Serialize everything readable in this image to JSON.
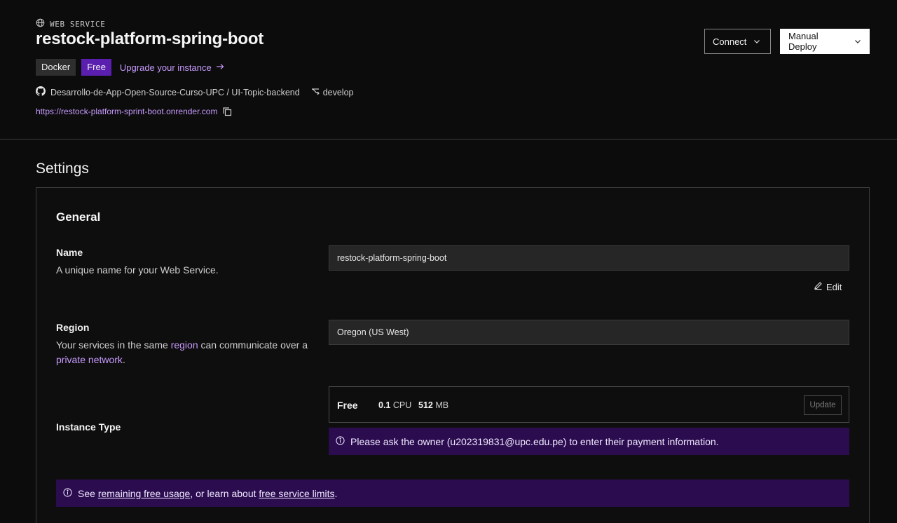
{
  "header": {
    "service_type": "WEB SERVICE",
    "title": "restock-platform-spring-boot",
    "badges": {
      "runtime": "Docker",
      "plan": "Free"
    },
    "upgrade_link": "Upgrade your instance",
    "repo": "Desarrollo-de-App-Open-Source-Curso-UPC / UI-Topic-backend",
    "branch": "develop",
    "url": "https://restock-platform-sprint-boot.onrender.com",
    "connect_label": "Connect",
    "deploy_label": "Manual Deploy"
  },
  "settings": {
    "title": "Settings",
    "general_title": "General",
    "name": {
      "label": "Name",
      "description": "A unique name for your Web Service.",
      "value": "restock-platform-spring-boot",
      "edit_label": "Edit"
    },
    "region": {
      "label": "Region",
      "desc_prefix": "Your services in the same ",
      "desc_link1": "region",
      "desc_middle": " can communicate over a ",
      "desc_link2": "private network",
      "desc_suffix": ".",
      "value": "Oregon (US West)"
    },
    "instance": {
      "label": "Instance Type",
      "plan": "Free",
      "cpu_value": "0.1",
      "cpu_unit": "CPU",
      "mem_value": "512",
      "mem_unit": "MB",
      "update_label": "Update",
      "notice": "Please ask the owner (u202319831@upc.edu.pe) to enter their payment information."
    },
    "usage_notice": {
      "prefix": "See ",
      "link1": "remaining free usage",
      "middle": ", or learn about ",
      "link2": "free service limits",
      "suffix": "."
    }
  },
  "colors": {
    "background": "#0c0c0c",
    "accent": "#c89bff",
    "plan_badge": "#5b1fb0",
    "notice_bg": "#2a0c4f"
  }
}
